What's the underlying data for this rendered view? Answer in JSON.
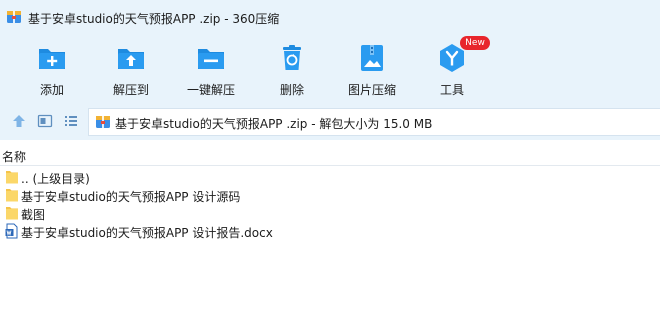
{
  "window": {
    "title": "基于安卓studio的天气预报APP .zip - 360压缩",
    "app_icon": "archive-icon"
  },
  "toolbar": {
    "items": [
      {
        "label": "添加",
        "icon": "add-folder-icon"
      },
      {
        "label": "解压到",
        "icon": "extract-folder-icon"
      },
      {
        "label": "一键解压",
        "icon": "quick-extract-icon"
      },
      {
        "label": "删除",
        "icon": "trash-icon"
      },
      {
        "label": "图片压缩",
        "icon": "image-compress-icon"
      },
      {
        "label": "工具",
        "icon": "tools-icon",
        "badge": "New"
      }
    ],
    "accent_color": "#1e8be0",
    "badge_color": "#e8252c"
  },
  "address": {
    "path_text": "基于安卓studio的天气预报APP .zip - 解包大小为 15.0 MB",
    "buttons": [
      "up-arrow-icon",
      "thumbnail-view-icon",
      "list-view-icon"
    ]
  },
  "list": {
    "columns": [
      "名称"
    ],
    "rows": [
      {
        "name": ".. (上级目录)",
        "type": "folder"
      },
      {
        "name": "基于安卓studio的天气预报APP 设计源码",
        "type": "folder"
      },
      {
        "name": "截图",
        "type": "folder"
      },
      {
        "name": "基于安卓studio的天气预报APP 设计报告.docx",
        "type": "docx"
      }
    ]
  }
}
